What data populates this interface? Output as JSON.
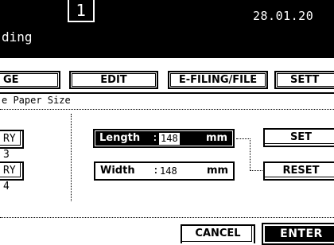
{
  "header": {
    "counter": "1",
    "date": "28.01.20",
    "title": "ding"
  },
  "tabs": {
    "image": "GE",
    "edit": "EDIT",
    "efiling": "E-FILING/FILE",
    "settings": "SETT"
  },
  "section": {
    "label": "e Paper Size"
  },
  "trays": {
    "tray3": "RY 3",
    "tray4": "RY 4"
  },
  "length": {
    "label": "Length",
    "colon": ":",
    "value": "148",
    "unit": "mm"
  },
  "width": {
    "label": "Width",
    "colon": ":",
    "value": "148",
    "unit": "mm"
  },
  "buttons": {
    "set": "SET",
    "reset": "RESET",
    "cancel": "CANCEL",
    "enter": "ENTER"
  }
}
